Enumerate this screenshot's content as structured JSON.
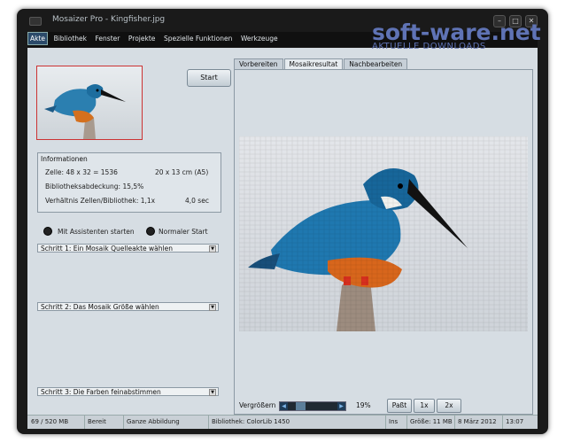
{
  "window": {
    "title": "Mosaizer Pro - Kingfisher.jpg"
  },
  "watermark": {
    "main": "soft-ware.net",
    "sub": "AKTUELLE DOWNLOADS"
  },
  "menu": {
    "items": [
      "Akte",
      "Bibliothek",
      "Fenster",
      "Projekte",
      "Spezielle Funktionen",
      "Werkzeuge"
    ]
  },
  "left": {
    "start_label": "Start",
    "info": {
      "title": "Informationen",
      "cells": "Zelle: 48 x 32 = 1536",
      "size": "20 x 13 cm  (A5)",
      "coverage": "Bibliotheksabdeckung: 15,5%",
      "ratio": "Verhältnis Zellen/Bibliothek: 1,1x",
      "time": "4,0 sec"
    },
    "radio_wizard": "Mit Assistenten starten",
    "radio_normal": "Normaler Start",
    "steps": [
      "Schritt 1: Ein Mosaik Quelleakte wählen",
      "Schritt 2: Das Mosaik Größe wählen",
      "Schritt 3: Die Farben feinabstimmen"
    ]
  },
  "tabs": [
    "Vorbereiten",
    "Mosaikresultat",
    "Nachbearbeiten"
  ],
  "zoom": {
    "label": "Vergrößern",
    "value": "19%",
    "value_fraction": 0.19,
    "buttons": [
      "Paßt",
      "1x",
      "2x"
    ]
  },
  "status": {
    "memory": "69 / 520 MB",
    "state": "Bereit",
    "view": "Ganze Abbildung",
    "library": "Bibliothek: ColorLib 1450",
    "ins": "Ins",
    "size": "Größe:  11 MB",
    "date": "8 März 2012",
    "time": "13:07"
  }
}
